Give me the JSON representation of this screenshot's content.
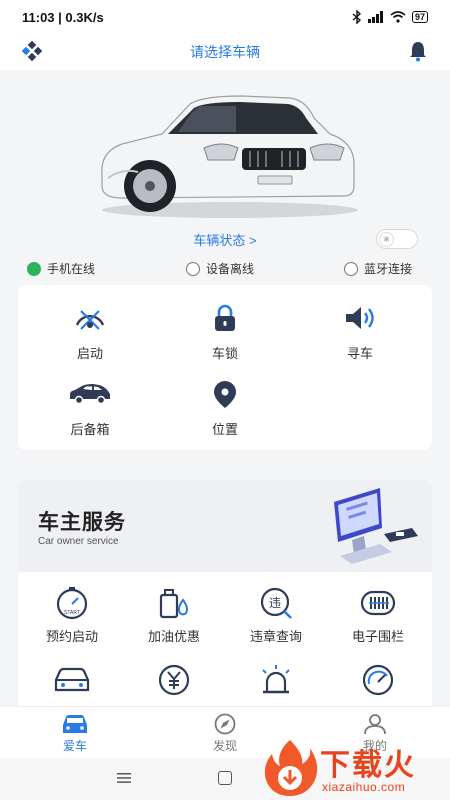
{
  "status_bar": {
    "time": "11:03 | 0.3K/s",
    "battery": "97"
  },
  "header": {
    "title": "请选择车辆"
  },
  "vehicle_status_label": "车辆状态 >",
  "connections": [
    {
      "label": "手机在线",
      "active": true
    },
    {
      "label": "设备离线",
      "active": false
    },
    {
      "label": "蓝牙连接",
      "active": false
    }
  ],
  "controls": [
    {
      "label": "启动",
      "icon": "engine-start-icon"
    },
    {
      "label": "车锁",
      "icon": "lock-icon"
    },
    {
      "label": "寻车",
      "icon": "horn-icon"
    },
    {
      "label": "后备箱",
      "icon": "car-trunk-icon"
    },
    {
      "label": "位置",
      "icon": "location-pin-icon"
    }
  ],
  "service": {
    "title": "车主服务",
    "subtitle": "Car owner service"
  },
  "service_items": [
    {
      "label": "预约启动",
      "icon": "stopwatch-icon"
    },
    {
      "label": "加油优惠",
      "icon": "fuel-can-icon"
    },
    {
      "label": "违章查询",
      "icon": "violation-icon"
    },
    {
      "label": "电子围栏",
      "icon": "fence-icon"
    },
    {
      "label": "",
      "icon": "car-icon"
    },
    {
      "label": "",
      "icon": "yen-icon"
    },
    {
      "label": "",
      "icon": "alarm-light-icon"
    },
    {
      "label": "",
      "icon": "speedometer-icon"
    }
  ],
  "tabs": [
    {
      "label": "爱车",
      "active": true,
      "icon": "car-icon"
    },
    {
      "label": "发现",
      "active": false,
      "icon": "compass-icon"
    },
    {
      "label": "我的",
      "active": false,
      "icon": "user-icon"
    }
  ],
  "watermark": {
    "title": "下载火",
    "domain": "xiazaihuo.com"
  },
  "colors": {
    "accent": "#2a7be4",
    "online": "#2fb25a",
    "icon_dark": "#2f3b57",
    "watermark": "#e8431c"
  }
}
